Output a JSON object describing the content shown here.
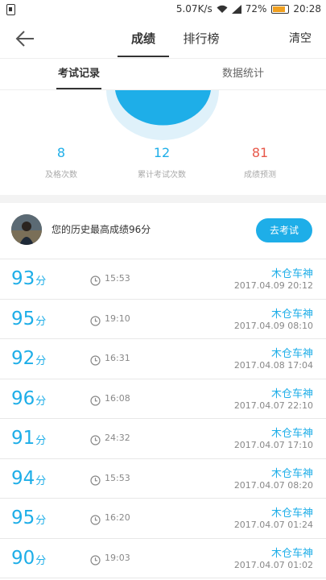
{
  "status_bar": {
    "net_speed": "5.07K/s",
    "battery_pct": "72%",
    "battery_level": 0.72,
    "clock": "20:28"
  },
  "header": {
    "tabs": [
      "成绩",
      "排行榜"
    ],
    "active_tab": 0,
    "clear_label": "清空"
  },
  "subtabs": {
    "records_label": "考试记录",
    "stats_label": "数据统计"
  },
  "stats": {
    "passed": {
      "value": "8",
      "label": "及格次数"
    },
    "total": {
      "value": "12",
      "label": "累计考试次数"
    },
    "predicted": {
      "value": "81",
      "label": "成绩预测"
    }
  },
  "best": {
    "text": "您的历史最高成绩96分",
    "button_label": "去考试"
  },
  "records": [
    {
      "score": "93",
      "unit": "分",
      "duration": "15:53",
      "name": "木仓车神",
      "date": "2017.04.09  20:12"
    },
    {
      "score": "95",
      "unit": "分",
      "duration": "19:10",
      "name": "木仓车神",
      "date": "2017.04.09  08:10"
    },
    {
      "score": "92",
      "unit": "分",
      "duration": "16:31",
      "name": "木仓车神",
      "date": "2017.04.08  17:04"
    },
    {
      "score": "96",
      "unit": "分",
      "duration": "16:08",
      "name": "木仓车神",
      "date": "2017.04.07  22:10"
    },
    {
      "score": "91",
      "unit": "分",
      "duration": "24:32",
      "name": "木仓车神",
      "date": "2017.04.07  17:10"
    },
    {
      "score": "94",
      "unit": "分",
      "duration": "15:53",
      "name": "木仓车神",
      "date": "2017.04.07  08:20"
    },
    {
      "score": "95",
      "unit": "分",
      "duration": "16:20",
      "name": "木仓车神",
      "date": "2017.04.07  01:24"
    },
    {
      "score": "90",
      "unit": "分",
      "duration": "19:03",
      "name": "木仓车神",
      "date": "2017.04.07  01:02"
    }
  ],
  "colors": {
    "accent": "#1eaee8",
    "predicted": "#e8584a",
    "gauge_ring": "#dff1fa"
  },
  "icons": {
    "back": "back-arrow-icon",
    "clock": "clock-icon"
  }
}
